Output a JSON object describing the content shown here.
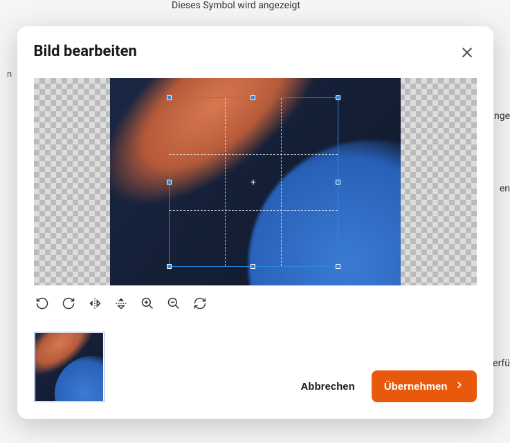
{
  "background": {
    "top_text": "Dieses Symbol wird angezeigt",
    "left_text": "n",
    "right1": "ange",
    "right2": "en",
    "right3": "erfü"
  },
  "modal": {
    "title": "Bild bearbeiten",
    "cancel_label": "Abbrechen",
    "apply_label": "Übernehmen",
    "crop_center": "+",
    "tools": {
      "rotate_left": "rotate-left-icon",
      "rotate_right": "rotate-right-icon",
      "flip_horizontal": "flip-horizontal-icon",
      "flip_vertical": "flip-vertical-icon",
      "zoom_in": "zoom-in-icon",
      "zoom_out": "zoom-out-icon",
      "reset": "reset-icon"
    }
  }
}
